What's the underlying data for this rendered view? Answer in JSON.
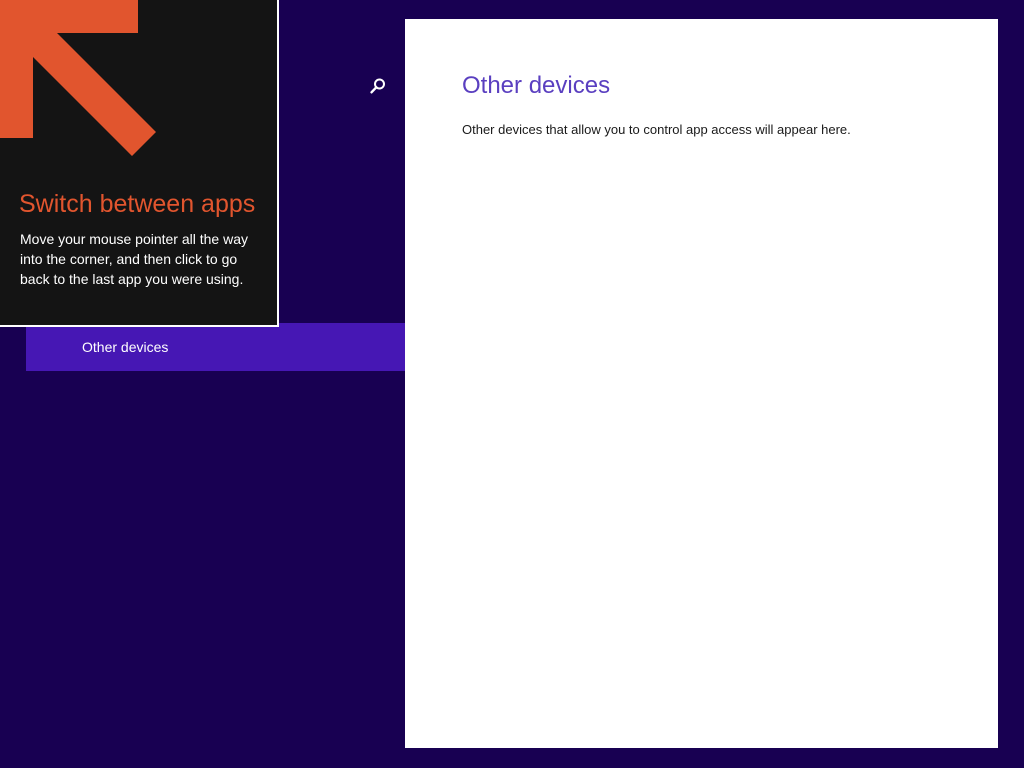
{
  "colors": {
    "background": "#180052",
    "nav_selected": "#4617b4",
    "tip_background": "#141414",
    "tip_accent": "#e1552e",
    "content_background": "#ffffff",
    "page_title": "#5a3fc0"
  },
  "left_pane": {
    "search_icon": "search-icon",
    "nav_items": [
      {
        "label": "Other devices",
        "selected": true
      }
    ]
  },
  "tip": {
    "arrow_icon": "arrow-up-left-icon",
    "title": "Switch between apps",
    "body": "Move your mouse pointer all the way into the corner, and then click to go back to the last app you were using."
  },
  "content": {
    "title": "Other devices",
    "description": "Other devices that allow you to control app access will appear here."
  }
}
